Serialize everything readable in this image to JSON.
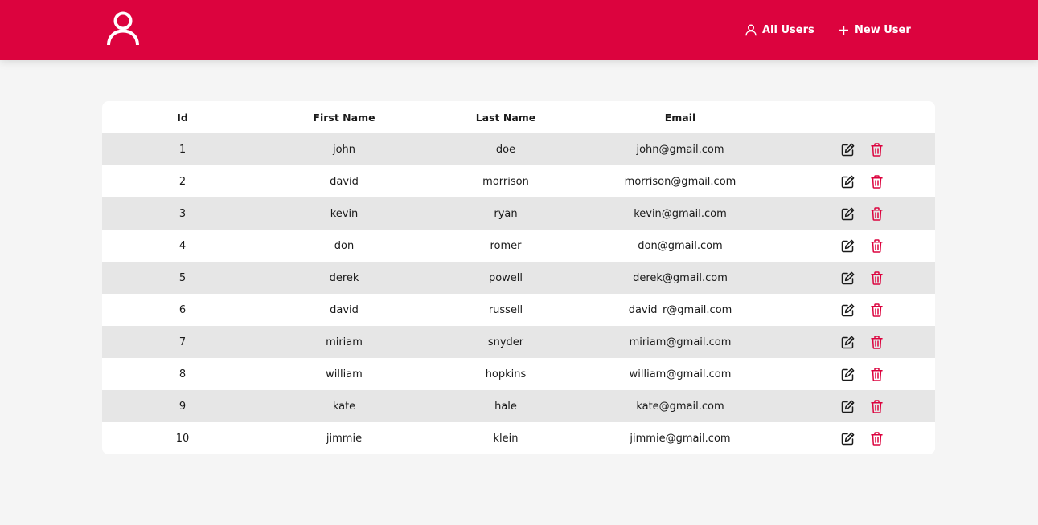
{
  "colors": {
    "brand": "#dc033e",
    "background": "#f5f5f5",
    "row_alt": "#e6e6e6",
    "delete_icon": "#dc033e"
  },
  "header": {
    "logo_icon": "user-icon",
    "nav": [
      {
        "label": "All Users",
        "icon": "user-icon"
      },
      {
        "label": "New User",
        "icon": "plus-icon"
      }
    ]
  },
  "table": {
    "columns": [
      "Id",
      "First Name",
      "Last Name",
      "Email"
    ],
    "row_action_icons": [
      "edit-icon",
      "trash-icon"
    ],
    "rows": [
      {
        "id": "1",
        "first": "john",
        "last": "doe",
        "email": "john@gmail.com"
      },
      {
        "id": "2",
        "first": "david",
        "last": "morrison",
        "email": "morrison@gmail.com"
      },
      {
        "id": "3",
        "first": "kevin",
        "last": "ryan",
        "email": "kevin@gmail.com"
      },
      {
        "id": "4",
        "first": "don",
        "last": "romer",
        "email": "don@gmail.com"
      },
      {
        "id": "5",
        "first": "derek",
        "last": "powell",
        "email": "derek@gmail.com"
      },
      {
        "id": "6",
        "first": "david",
        "last": "russell",
        "email": "david_r@gmail.com"
      },
      {
        "id": "7",
        "first": "miriam",
        "last": "snyder",
        "email": "miriam@gmail.com"
      },
      {
        "id": "8",
        "first": "william",
        "last": "hopkins",
        "email": "william@gmail.com"
      },
      {
        "id": "9",
        "first": "kate",
        "last": "hale",
        "email": "kate@gmail.com"
      },
      {
        "id": "10",
        "first": "jimmie",
        "last": "klein",
        "email": "jimmie@gmail.com"
      }
    ]
  }
}
